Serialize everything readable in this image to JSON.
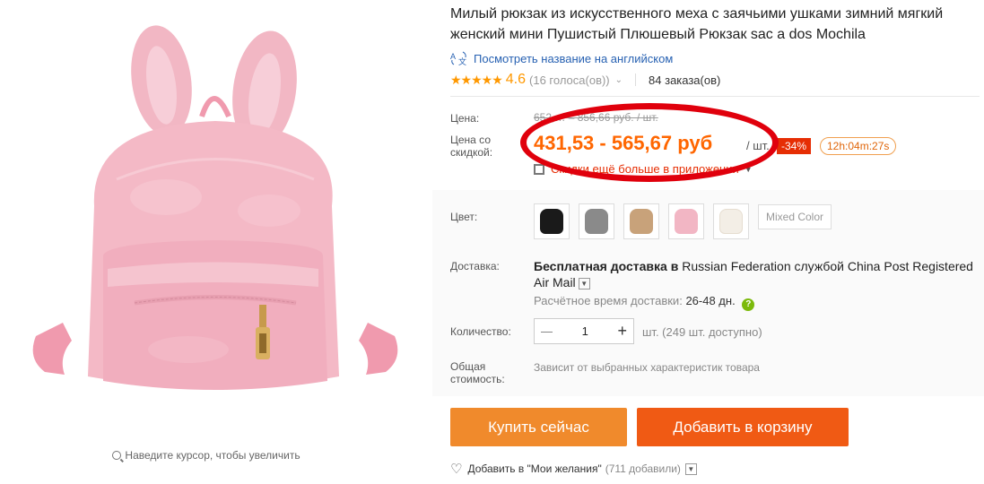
{
  "gallery": {
    "zoom_hint": "Наведите курсор, чтобы увеличить"
  },
  "product": {
    "title": "Милый рюкзак из искусственного меха с заячьими ушками зимний мягкий женский мини Пушистый Плюшевый Рюкзак sac a dos Mochila",
    "translate_link": "Посмотреть название на английском",
    "rating": "4.6",
    "votes": "(16 голоса(ов))",
    "orders": "84 заказа(ов)",
    "stars": "★★★★★"
  },
  "price": {
    "label": "Цена:",
    "old": "652,… – 856,66 руб. / шт.",
    "discount_label_1": "Цена со",
    "discount_label_2": "скидкой:",
    "new": "431,53 - 565,67 руб",
    "per_unit": "/ шт.",
    "discount_badge": "-34%",
    "timer": "12h:04m:27s",
    "coupon_text": "Скидки ещё больше в приложении"
  },
  "color": {
    "label": "Цвет:",
    "mixed_label": "Mixed Color",
    "swatch_colors": [
      "#1a1a1a",
      "#8a8a8a",
      "#c8a27a",
      "#f2b6c4",
      "#f3eee6"
    ]
  },
  "shipping": {
    "label": "Доставка:",
    "free": "Бесплатная доставка в",
    "country": "Russian Federation",
    "service_prefix": "службой",
    "service": "China Post Registered Air Mail",
    "time_label": "Расчётное время доставки:",
    "time_value": "26-48 дн."
  },
  "quantity": {
    "label": "Количество:",
    "value": "1",
    "minus": "—",
    "plus": "+",
    "available": "шт. (249 шт. доступно)"
  },
  "total": {
    "label_1": "Общая",
    "label_2": "стоимость:",
    "text": "Зависит от выбранных характеристик товара"
  },
  "actions": {
    "buy": "Купить сейчас",
    "cart": "Добавить в корзину",
    "wish": "Добавить в \"Мои желания\"",
    "wish_count": "(711 добавили)"
  }
}
